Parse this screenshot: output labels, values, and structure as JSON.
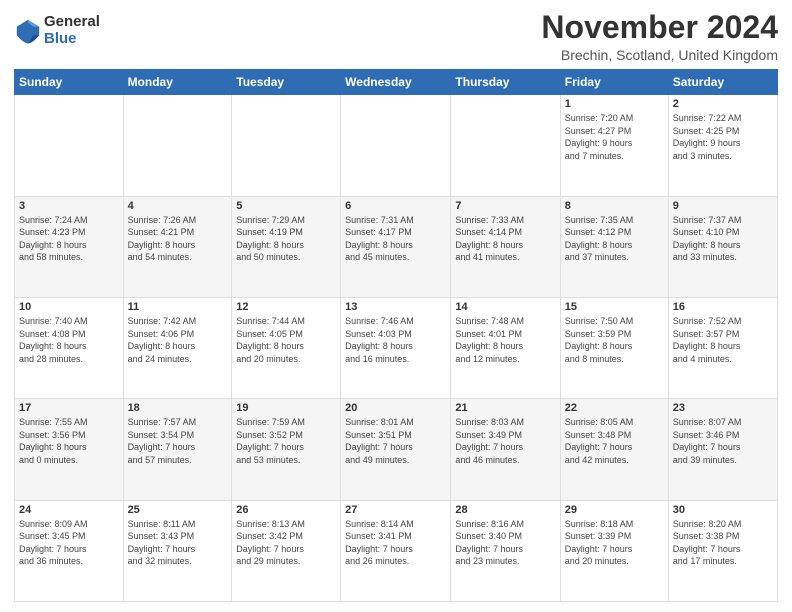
{
  "logo": {
    "general": "General",
    "blue": "Blue"
  },
  "header": {
    "month": "November 2024",
    "location": "Brechin, Scotland, United Kingdom"
  },
  "days_of_week": [
    "Sunday",
    "Monday",
    "Tuesday",
    "Wednesday",
    "Thursday",
    "Friday",
    "Saturday"
  ],
  "weeks": [
    [
      {
        "day": "",
        "info": ""
      },
      {
        "day": "",
        "info": ""
      },
      {
        "day": "",
        "info": ""
      },
      {
        "day": "",
        "info": ""
      },
      {
        "day": "",
        "info": ""
      },
      {
        "day": "1",
        "info": "Sunrise: 7:20 AM\nSunset: 4:27 PM\nDaylight: 9 hours\nand 7 minutes."
      },
      {
        "day": "2",
        "info": "Sunrise: 7:22 AM\nSunset: 4:25 PM\nDaylight: 9 hours\nand 3 minutes."
      }
    ],
    [
      {
        "day": "3",
        "info": "Sunrise: 7:24 AM\nSunset: 4:23 PM\nDaylight: 8 hours\nand 58 minutes."
      },
      {
        "day": "4",
        "info": "Sunrise: 7:26 AM\nSunset: 4:21 PM\nDaylight: 8 hours\nand 54 minutes."
      },
      {
        "day": "5",
        "info": "Sunrise: 7:29 AM\nSunset: 4:19 PM\nDaylight: 8 hours\nand 50 minutes."
      },
      {
        "day": "6",
        "info": "Sunrise: 7:31 AM\nSunset: 4:17 PM\nDaylight: 8 hours\nand 45 minutes."
      },
      {
        "day": "7",
        "info": "Sunrise: 7:33 AM\nSunset: 4:14 PM\nDaylight: 8 hours\nand 41 minutes."
      },
      {
        "day": "8",
        "info": "Sunrise: 7:35 AM\nSunset: 4:12 PM\nDaylight: 8 hours\nand 37 minutes."
      },
      {
        "day": "9",
        "info": "Sunrise: 7:37 AM\nSunset: 4:10 PM\nDaylight: 8 hours\nand 33 minutes."
      }
    ],
    [
      {
        "day": "10",
        "info": "Sunrise: 7:40 AM\nSunset: 4:08 PM\nDaylight: 8 hours\nand 28 minutes."
      },
      {
        "day": "11",
        "info": "Sunrise: 7:42 AM\nSunset: 4:06 PM\nDaylight: 8 hours\nand 24 minutes."
      },
      {
        "day": "12",
        "info": "Sunrise: 7:44 AM\nSunset: 4:05 PM\nDaylight: 8 hours\nand 20 minutes."
      },
      {
        "day": "13",
        "info": "Sunrise: 7:46 AM\nSunset: 4:03 PM\nDaylight: 8 hours\nand 16 minutes."
      },
      {
        "day": "14",
        "info": "Sunrise: 7:48 AM\nSunset: 4:01 PM\nDaylight: 8 hours\nand 12 minutes."
      },
      {
        "day": "15",
        "info": "Sunrise: 7:50 AM\nSunset: 3:59 PM\nDaylight: 8 hours\nand 8 minutes."
      },
      {
        "day": "16",
        "info": "Sunrise: 7:52 AM\nSunset: 3:57 PM\nDaylight: 8 hours\nand 4 minutes."
      }
    ],
    [
      {
        "day": "17",
        "info": "Sunrise: 7:55 AM\nSunset: 3:56 PM\nDaylight: 8 hours\nand 0 minutes."
      },
      {
        "day": "18",
        "info": "Sunrise: 7:57 AM\nSunset: 3:54 PM\nDaylight: 7 hours\nand 57 minutes."
      },
      {
        "day": "19",
        "info": "Sunrise: 7:59 AM\nSunset: 3:52 PM\nDaylight: 7 hours\nand 53 minutes."
      },
      {
        "day": "20",
        "info": "Sunrise: 8:01 AM\nSunset: 3:51 PM\nDaylight: 7 hours\nand 49 minutes."
      },
      {
        "day": "21",
        "info": "Sunrise: 8:03 AM\nSunset: 3:49 PM\nDaylight: 7 hours\nand 46 minutes."
      },
      {
        "day": "22",
        "info": "Sunrise: 8:05 AM\nSunset: 3:48 PM\nDaylight: 7 hours\nand 42 minutes."
      },
      {
        "day": "23",
        "info": "Sunrise: 8:07 AM\nSunset: 3:46 PM\nDaylight: 7 hours\nand 39 minutes."
      }
    ],
    [
      {
        "day": "24",
        "info": "Sunrise: 8:09 AM\nSunset: 3:45 PM\nDaylight: 7 hours\nand 36 minutes."
      },
      {
        "day": "25",
        "info": "Sunrise: 8:11 AM\nSunset: 3:43 PM\nDaylight: 7 hours\nand 32 minutes."
      },
      {
        "day": "26",
        "info": "Sunrise: 8:13 AM\nSunset: 3:42 PM\nDaylight: 7 hours\nand 29 minutes."
      },
      {
        "day": "27",
        "info": "Sunrise: 8:14 AM\nSunset: 3:41 PM\nDaylight: 7 hours\nand 26 minutes."
      },
      {
        "day": "28",
        "info": "Sunrise: 8:16 AM\nSunset: 3:40 PM\nDaylight: 7 hours\nand 23 minutes."
      },
      {
        "day": "29",
        "info": "Sunrise: 8:18 AM\nSunset: 3:39 PM\nDaylight: 7 hours\nand 20 minutes."
      },
      {
        "day": "30",
        "info": "Sunrise: 8:20 AM\nSunset: 3:38 PM\nDaylight: 7 hours\nand 17 minutes."
      }
    ]
  ]
}
